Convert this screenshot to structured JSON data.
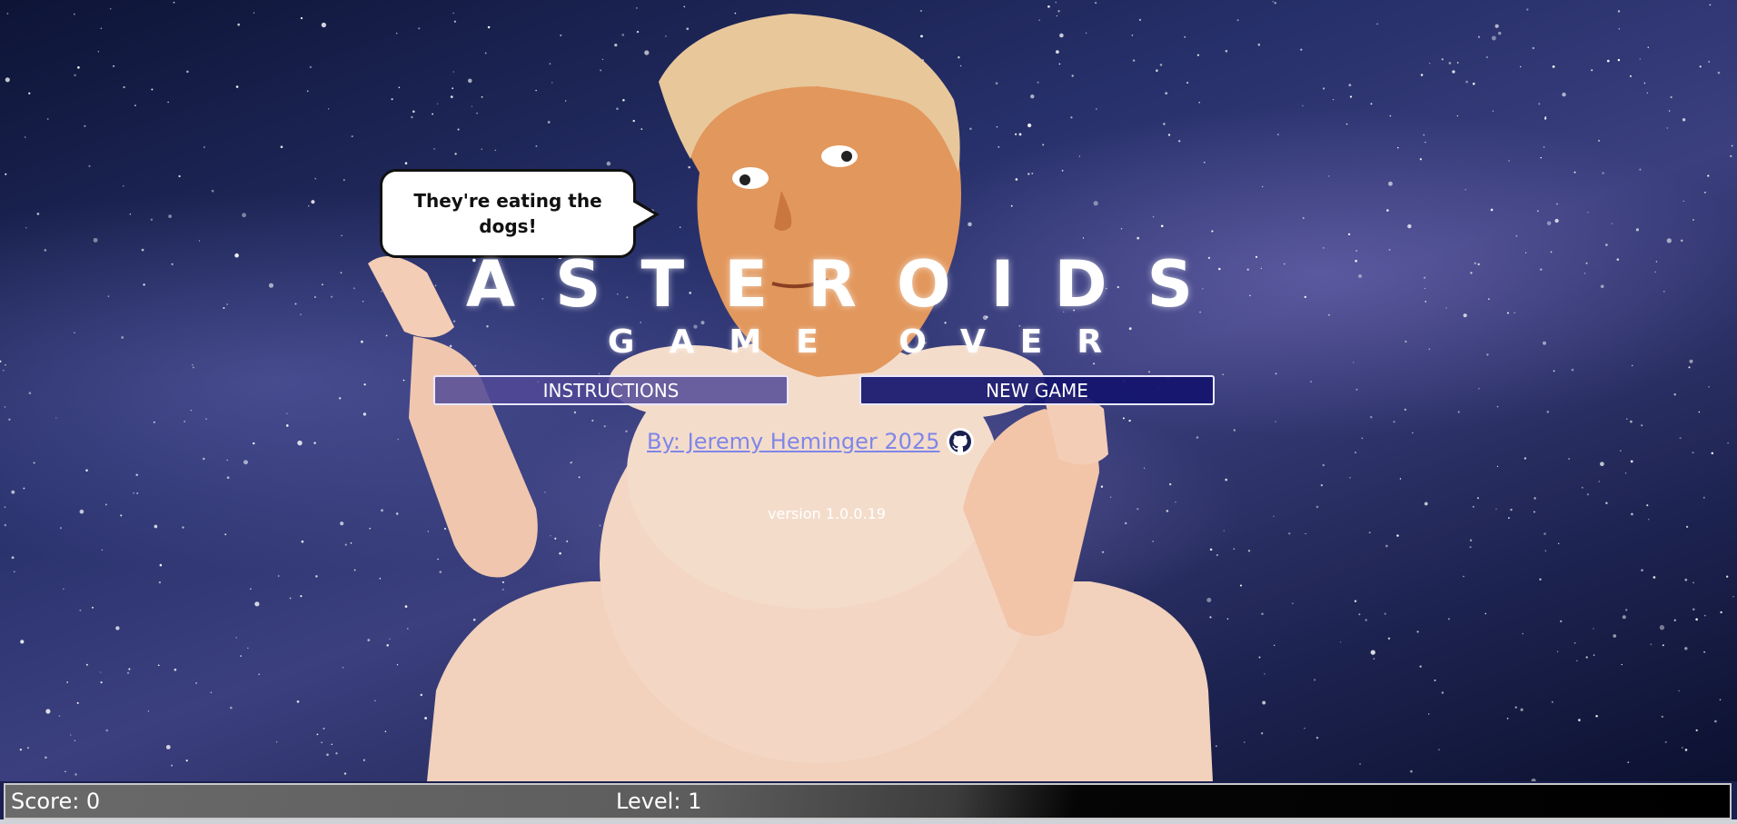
{
  "speech": {
    "text": "They're eating the dogs!"
  },
  "title": "ASTEROIDS",
  "subtitle": "GAME OVER",
  "menu": {
    "instructions_label": "INSTRUCTIONS",
    "new_game_label": "NEW GAME"
  },
  "author": {
    "link_text": "By: Jeremy Heminger 2025",
    "icon": "github-icon"
  },
  "version": "version 1.0.0.19",
  "status": {
    "score": "Score: 0",
    "level": "Level: 1"
  },
  "colors": {
    "instructions_button_bg": "#504896",
    "new_game_button_bg": "#14146e",
    "link_color": "#7f86e8",
    "status_bar_dark": "#000000"
  }
}
